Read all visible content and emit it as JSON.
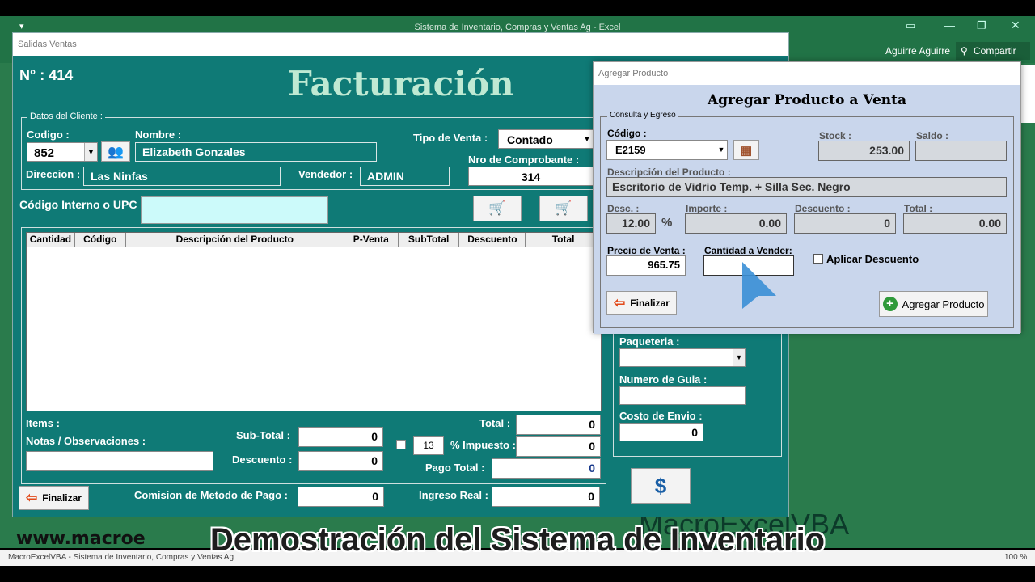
{
  "excel": {
    "window_title": "Sistema de Inventario, Compras y Ventas Ag - Excel",
    "user": "Aguirre Aguirre",
    "share": "Compartir",
    "status_left": "MacroExcelVBA - Sistema de Inventario, Compras y Ventas Ag",
    "zoom": "100 %",
    "watermark_url": "www.macroe",
    "watermark_brand": "MacroExcelVBA"
  },
  "main": {
    "window_title": "Salidas Ventas",
    "number_label": "N° : 414",
    "heading": "Facturación",
    "client_frame": "Datos del Cliente  :",
    "codigo_label": "Codigo :",
    "codigo_value": "852",
    "nombre_label": "Nombre :",
    "nombre_value": "Elizabeth Gonzales",
    "direccion_label": "Direccion :",
    "direccion_value": "Las Ninfas",
    "vendedor_label": "Vendedor :",
    "vendedor_value": "ADMIN",
    "tipo_venta_label": "Tipo de Venta :",
    "tipo_venta_value": "Contado",
    "comprobante_label": "Nro de Comprobante :",
    "comprobante_value": "314",
    "upc_label": "Código Interno o UPC :",
    "table_headers": [
      "Cantidad",
      "Código",
      "Descripción del Producto",
      "P-Venta",
      "SubTotal",
      "Descuento",
      "Total"
    ],
    "items_label": "Items :",
    "notas_label": "Notas / Observaciones :",
    "subtotal_label": "Sub-Total :",
    "subtotal_value": "0",
    "descuento_label": "Descuento :",
    "descuento_value": "0",
    "total_label": "Total :",
    "total_value": "0",
    "impuesto_pct": "13",
    "impuesto_label": "% Impuesto :",
    "impuesto_value": "0",
    "pago_total_label": "Pago Total :",
    "pago_total_value": "0",
    "comision_label": "Comision de Metodo de Pago :",
    "comision_value": "0",
    "ingreso_label": "Ingreso Real :",
    "ingreso_value": "0",
    "finalizar": "Finalizar",
    "paqueteria_label": "Paqueteria :",
    "guia_label": "Numero de Guia :",
    "envio_label": "Costo de Envio :",
    "envio_value": "0"
  },
  "dialog": {
    "window_title": "Agregar Producto",
    "heading": "Agregar Producto a Venta",
    "frame": "Consulta y Egreso",
    "codigo_label": "Código :",
    "codigo_value": "E2159",
    "stock_label": "Stock :",
    "stock_value": "253.00",
    "saldo_label": "Saldo :",
    "descripcion_label": "Descripción del Producto :",
    "descripcion_value": "Escritorio de Vidrio Temp. + Silla Sec. Negro",
    "desc_label": "Desc. :",
    "desc_value": "12.00",
    "pct_sign": "%",
    "importe_label": "Importe :",
    "importe_value": "0.00",
    "descuento_label": "Descuento :",
    "descuento_value": "0",
    "total_label": "Total :",
    "total_value": "0.00",
    "precio_label": "Precio de Venta :",
    "precio_value": "965.75",
    "cantidad_label": "Cantidad a Vender:",
    "aplicar_label": "Aplicar Descuento",
    "finalizar": "Finalizar",
    "agregar": "Agregar Producto"
  },
  "caption": "Demostración del Sistema de Inventario",
  "colors": {
    "teal": "#0f7a76",
    "excel_green": "#217346",
    "dialog_bg": "#c9d6ec"
  }
}
